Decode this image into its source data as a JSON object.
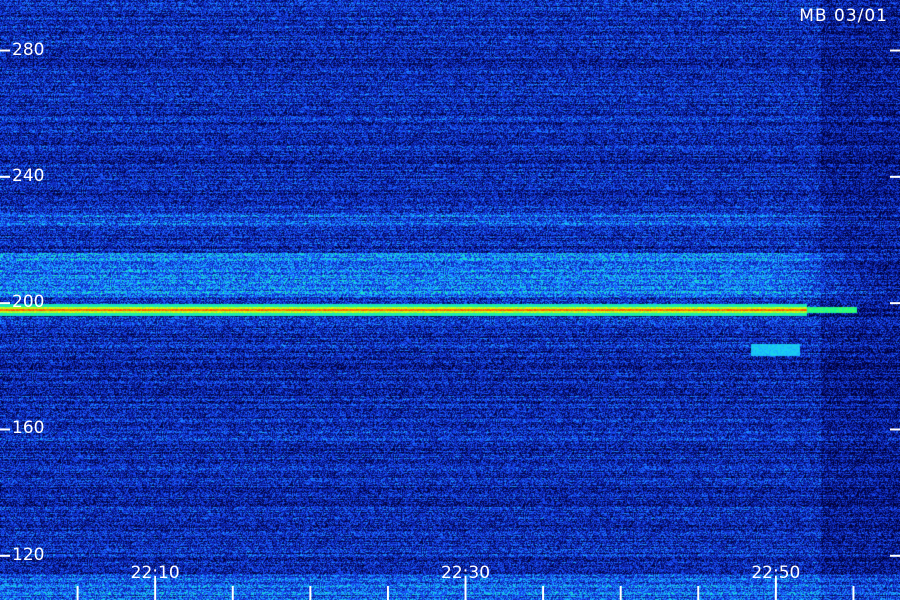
{
  "station_label": "MB 03/01",
  "chart_data": {
    "type": "heatmap",
    "y_ticks": [
      120,
      160,
      200,
      240,
      280
    ],
    "y_tick_labels": [
      "120",
      "160",
      "200",
      "240",
      "280"
    ],
    "ylim": [
      106,
      296
    ],
    "x_ticks": [
      "22:10",
      "22:30",
      "22:50"
    ],
    "x_minor_every_minutes": 5,
    "xlim_minutes": [
      0,
      58
    ],
    "x_major_minute_offsets": [
      10,
      30,
      50
    ],
    "features": {
      "carrier_line": {
        "value": 198,
        "end_minute": 52,
        "intensity": "high"
      },
      "band_bright": {
        "from": 202,
        "to": 216,
        "intensity": "medium"
      },
      "band_faint": {
        "from": 225,
        "to": 229,
        "intensity": "low"
      },
      "floor_noise": {
        "from": 106,
        "to": 114,
        "intensity": "medium"
      }
    },
    "colors": [
      "#000033",
      "#0a1ea0",
      "#1a4fff",
      "#19c8ff",
      "#1cff80",
      "#e8ff00",
      "#ff3b00"
    ]
  }
}
